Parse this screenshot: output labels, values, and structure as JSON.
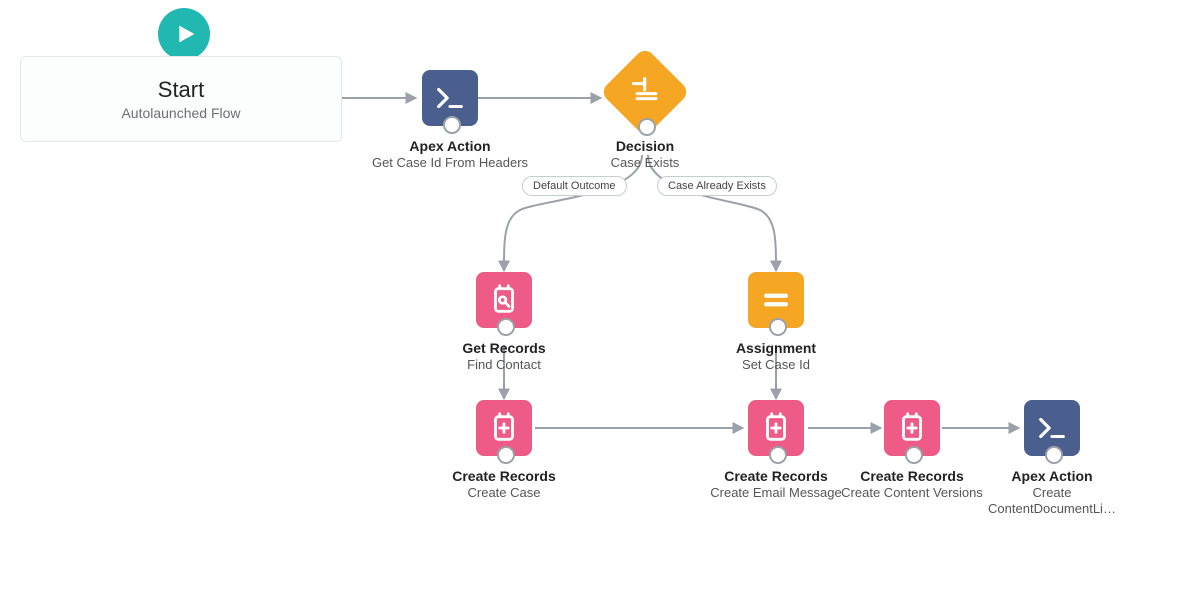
{
  "start": {
    "title": "Start",
    "subtitle": "Autolaunched Flow"
  },
  "nodes": {
    "apexAction1": {
      "title": "Apex Action",
      "sub": "Get Case Id From Headers"
    },
    "decision": {
      "title": "Decision",
      "sub": "Case Exists"
    },
    "getRecords": {
      "title": "Get Records",
      "sub": "Find Contact"
    },
    "assignment": {
      "title": "Assignment",
      "sub": "Set Case Id"
    },
    "createCase": {
      "title": "Create Records",
      "sub": "Create Case"
    },
    "createEmail": {
      "title": "Create Records",
      "sub": "Create Email Message"
    },
    "createContent": {
      "title": "Create Records",
      "sub": "Create Content Versions"
    },
    "apexAction2": {
      "title": "Apex Action",
      "sub": "Create ContentDocumentLi…"
    }
  },
  "outcomes": {
    "default": "Default Outcome",
    "exists": "Case Already Exists"
  },
  "colors": {
    "start": "#21b8b2",
    "apex": "#4b5f8f",
    "decision": "#f5a623",
    "assignment": "#f5a623",
    "record": "#ee5b86",
    "connector": "#9aa1a8"
  }
}
